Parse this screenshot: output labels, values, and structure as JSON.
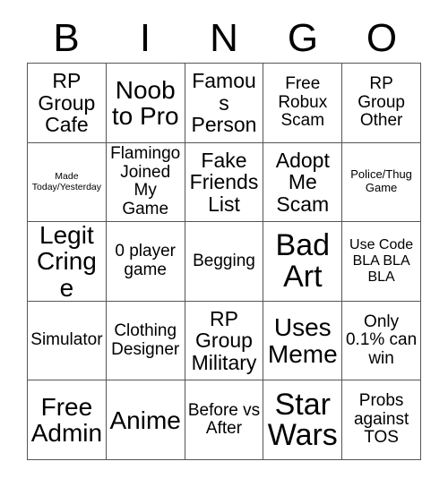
{
  "header": {
    "letters": [
      "B",
      "I",
      "N",
      "G",
      "O"
    ]
  },
  "grid": {
    "rows": 5,
    "columns": 5,
    "border_color": "#555555",
    "cell_background": "#ffffff",
    "text_color": "#000000",
    "cells": [
      {
        "text": "RP Group Cafe",
        "size": "l"
      },
      {
        "text": "Noob to Pro",
        "size": "xl"
      },
      {
        "text": "Famous Person",
        "size": "l"
      },
      {
        "text": "Free Robux Scam",
        "size": "m"
      },
      {
        "text": "RP Group Other",
        "size": "m"
      },
      {
        "text": "Made Today/Yesterday",
        "size": "xxs"
      },
      {
        "text": "Flamingo Joined My Game",
        "size": "m"
      },
      {
        "text": "Fake Friends List",
        "size": "l"
      },
      {
        "text": "Adopt Me Scam",
        "size": "l"
      },
      {
        "text": "Police/Thug Game",
        "size": "xs"
      },
      {
        "text": "Legit Cringe",
        "size": "xl"
      },
      {
        "text": "0 player game",
        "size": "m"
      },
      {
        "text": "Begging",
        "size": "m"
      },
      {
        "text": "Bad Art",
        "size": "xxl"
      },
      {
        "text": "Use Code BLA BLA BLA",
        "size": "s"
      },
      {
        "text": "Simulator",
        "size": "m"
      },
      {
        "text": "Clothing Designer",
        "size": "m"
      },
      {
        "text": "RP Group Military",
        "size": "l"
      },
      {
        "text": "Uses Meme",
        "size": "xl"
      },
      {
        "text": "Only 0.1% can win",
        "size": "m"
      },
      {
        "text": "Free Admin",
        "size": "xl"
      },
      {
        "text": "Anime",
        "size": "xl"
      },
      {
        "text": "Before vs After",
        "size": "m"
      },
      {
        "text": "Star Wars",
        "size": "xxl"
      },
      {
        "text": "Probs against TOS",
        "size": "m"
      }
    ]
  }
}
